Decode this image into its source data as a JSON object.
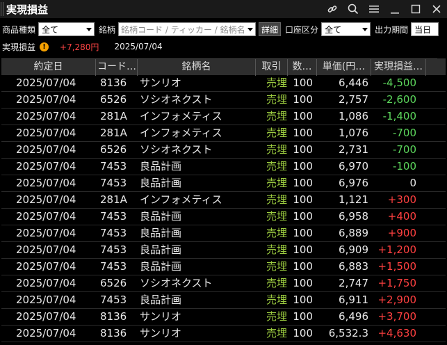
{
  "window": {
    "title": "実現損益",
    "icons": [
      "link-icon",
      "search-icon",
      "menu-icon",
      "minimize-icon",
      "maximize-icon",
      "close-icon"
    ]
  },
  "filters": {
    "product_type_label": "商品種類",
    "product_type_value": "全て",
    "symbol_label": "銘柄",
    "symbol_placeholder": "銘柄コード / ティッカー / 銘柄名",
    "detail_button": "詳細",
    "account_label": "口座区分",
    "account_value": "全て",
    "output_period_label": "出力期間",
    "output_period_value": "当日"
  },
  "summary": {
    "label": "実現損益",
    "warning": "!",
    "total": "+7,280円",
    "date": "2025/07/04"
  },
  "table": {
    "headers": [
      "約定日",
      "コード…",
      "銘柄名",
      "取引",
      "数…",
      "単価(円…",
      "実現損益…"
    ],
    "rows": [
      {
        "date": "2025/07/04",
        "code": "8136",
        "name": "サンリオ",
        "side": "売埋",
        "qty": "100",
        "price": "6,446",
        "pnl": "-4,500",
        "sign": "neg"
      },
      {
        "date": "2025/07/04",
        "code": "6526",
        "name": "ソシオネクスト",
        "side": "売埋",
        "qty": "100",
        "price": "2,757",
        "pnl": "-2,600",
        "sign": "neg"
      },
      {
        "date": "2025/07/04",
        "code": "281A",
        "name": "インフォメティス",
        "side": "売埋",
        "qty": "100",
        "price": "1,086",
        "pnl": "-1,400",
        "sign": "neg"
      },
      {
        "date": "2025/07/04",
        "code": "281A",
        "name": "インフォメティス",
        "side": "売埋",
        "qty": "100",
        "price": "1,076",
        "pnl": "-700",
        "sign": "neg"
      },
      {
        "date": "2025/07/04",
        "code": "6526",
        "name": "ソシオネクスト",
        "side": "売埋",
        "qty": "100",
        "price": "2,731",
        "pnl": "-700",
        "sign": "neg"
      },
      {
        "date": "2025/07/04",
        "code": "7453",
        "name": "良品計画",
        "side": "売埋",
        "qty": "100",
        "price": "6,970",
        "pnl": "-100",
        "sign": "neg"
      },
      {
        "date": "2025/07/04",
        "code": "7453",
        "name": "良品計画",
        "side": "売埋",
        "qty": "100",
        "price": "6,976",
        "pnl": "0",
        "sign": "zero"
      },
      {
        "date": "2025/07/04",
        "code": "281A",
        "name": "インフォメティス",
        "side": "売埋",
        "qty": "100",
        "price": "1,121",
        "pnl": "+300",
        "sign": "pos"
      },
      {
        "date": "2025/07/04",
        "code": "7453",
        "name": "良品計画",
        "side": "売埋",
        "qty": "100",
        "price": "6,958",
        "pnl": "+400",
        "sign": "pos"
      },
      {
        "date": "2025/07/04",
        "code": "7453",
        "name": "良品計画",
        "side": "売埋",
        "qty": "100",
        "price": "6,889",
        "pnl": "+900",
        "sign": "pos"
      },
      {
        "date": "2025/07/04",
        "code": "7453",
        "name": "良品計画",
        "side": "売埋",
        "qty": "100",
        "price": "6,909",
        "pnl": "+1,200",
        "sign": "pos"
      },
      {
        "date": "2025/07/04",
        "code": "7453",
        "name": "良品計画",
        "side": "売埋",
        "qty": "100",
        "price": "6,883",
        "pnl": "+1,500",
        "sign": "pos"
      },
      {
        "date": "2025/07/04",
        "code": "6526",
        "name": "ソシオネクスト",
        "side": "売埋",
        "qty": "100",
        "price": "2,747",
        "pnl": "+1,750",
        "sign": "pos"
      },
      {
        "date": "2025/07/04",
        "code": "7453",
        "name": "良品計画",
        "side": "売埋",
        "qty": "100",
        "price": "6,911",
        "pnl": "+2,900",
        "sign": "pos"
      },
      {
        "date": "2025/07/04",
        "code": "8136",
        "name": "サンリオ",
        "side": "売埋",
        "qty": "100",
        "price": "6,496",
        "pnl": "+3,700",
        "sign": "pos"
      },
      {
        "date": "2025/07/04",
        "code": "8136",
        "name": "サンリオ",
        "side": "売埋",
        "qty": "100",
        "price": "6,532.3",
        "pnl": "+4,630",
        "sign": "pos"
      }
    ]
  },
  "colors": {
    "positive": "#ff4040",
    "negative": "#5cd65c",
    "side": "#9ccc40",
    "warning": "#f5a000"
  }
}
